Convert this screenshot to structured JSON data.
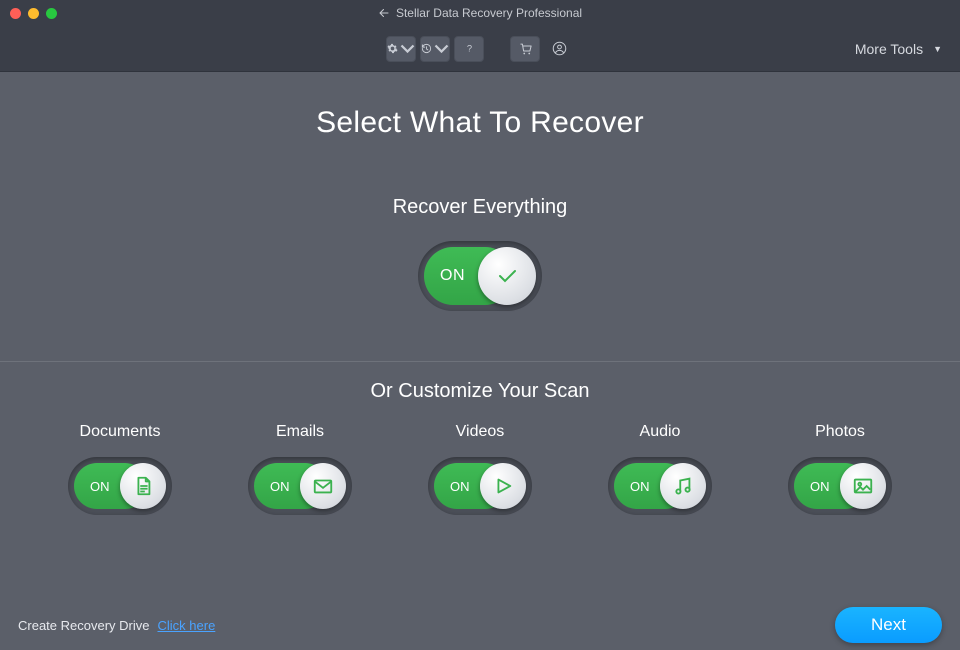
{
  "window": {
    "title": "Stellar Data Recovery Professional"
  },
  "toolbar": {
    "more_tools": "More Tools"
  },
  "page": {
    "title": "Select What To Recover",
    "recover_all_label": "Recover Everything",
    "customize_label": "Or Customize Your Scan",
    "toggle_on": "ON"
  },
  "recover_all": {
    "state": "ON"
  },
  "categories": [
    {
      "label": "Documents",
      "state": "ON",
      "icon": "document-icon"
    },
    {
      "label": "Emails",
      "state": "ON",
      "icon": "mail-icon"
    },
    {
      "label": "Videos",
      "state": "ON",
      "icon": "play-icon"
    },
    {
      "label": "Audio",
      "state": "ON",
      "icon": "music-icon"
    },
    {
      "label": "Photos",
      "state": "ON",
      "icon": "image-icon"
    }
  ],
  "footer": {
    "create_drive_label": "Create Recovery Drive",
    "click_here": "Click here",
    "next": "Next"
  },
  "colors": {
    "accent_green": "#3bb24f",
    "accent_blue": "#0fa4ff",
    "bg": "#5b5f69"
  }
}
